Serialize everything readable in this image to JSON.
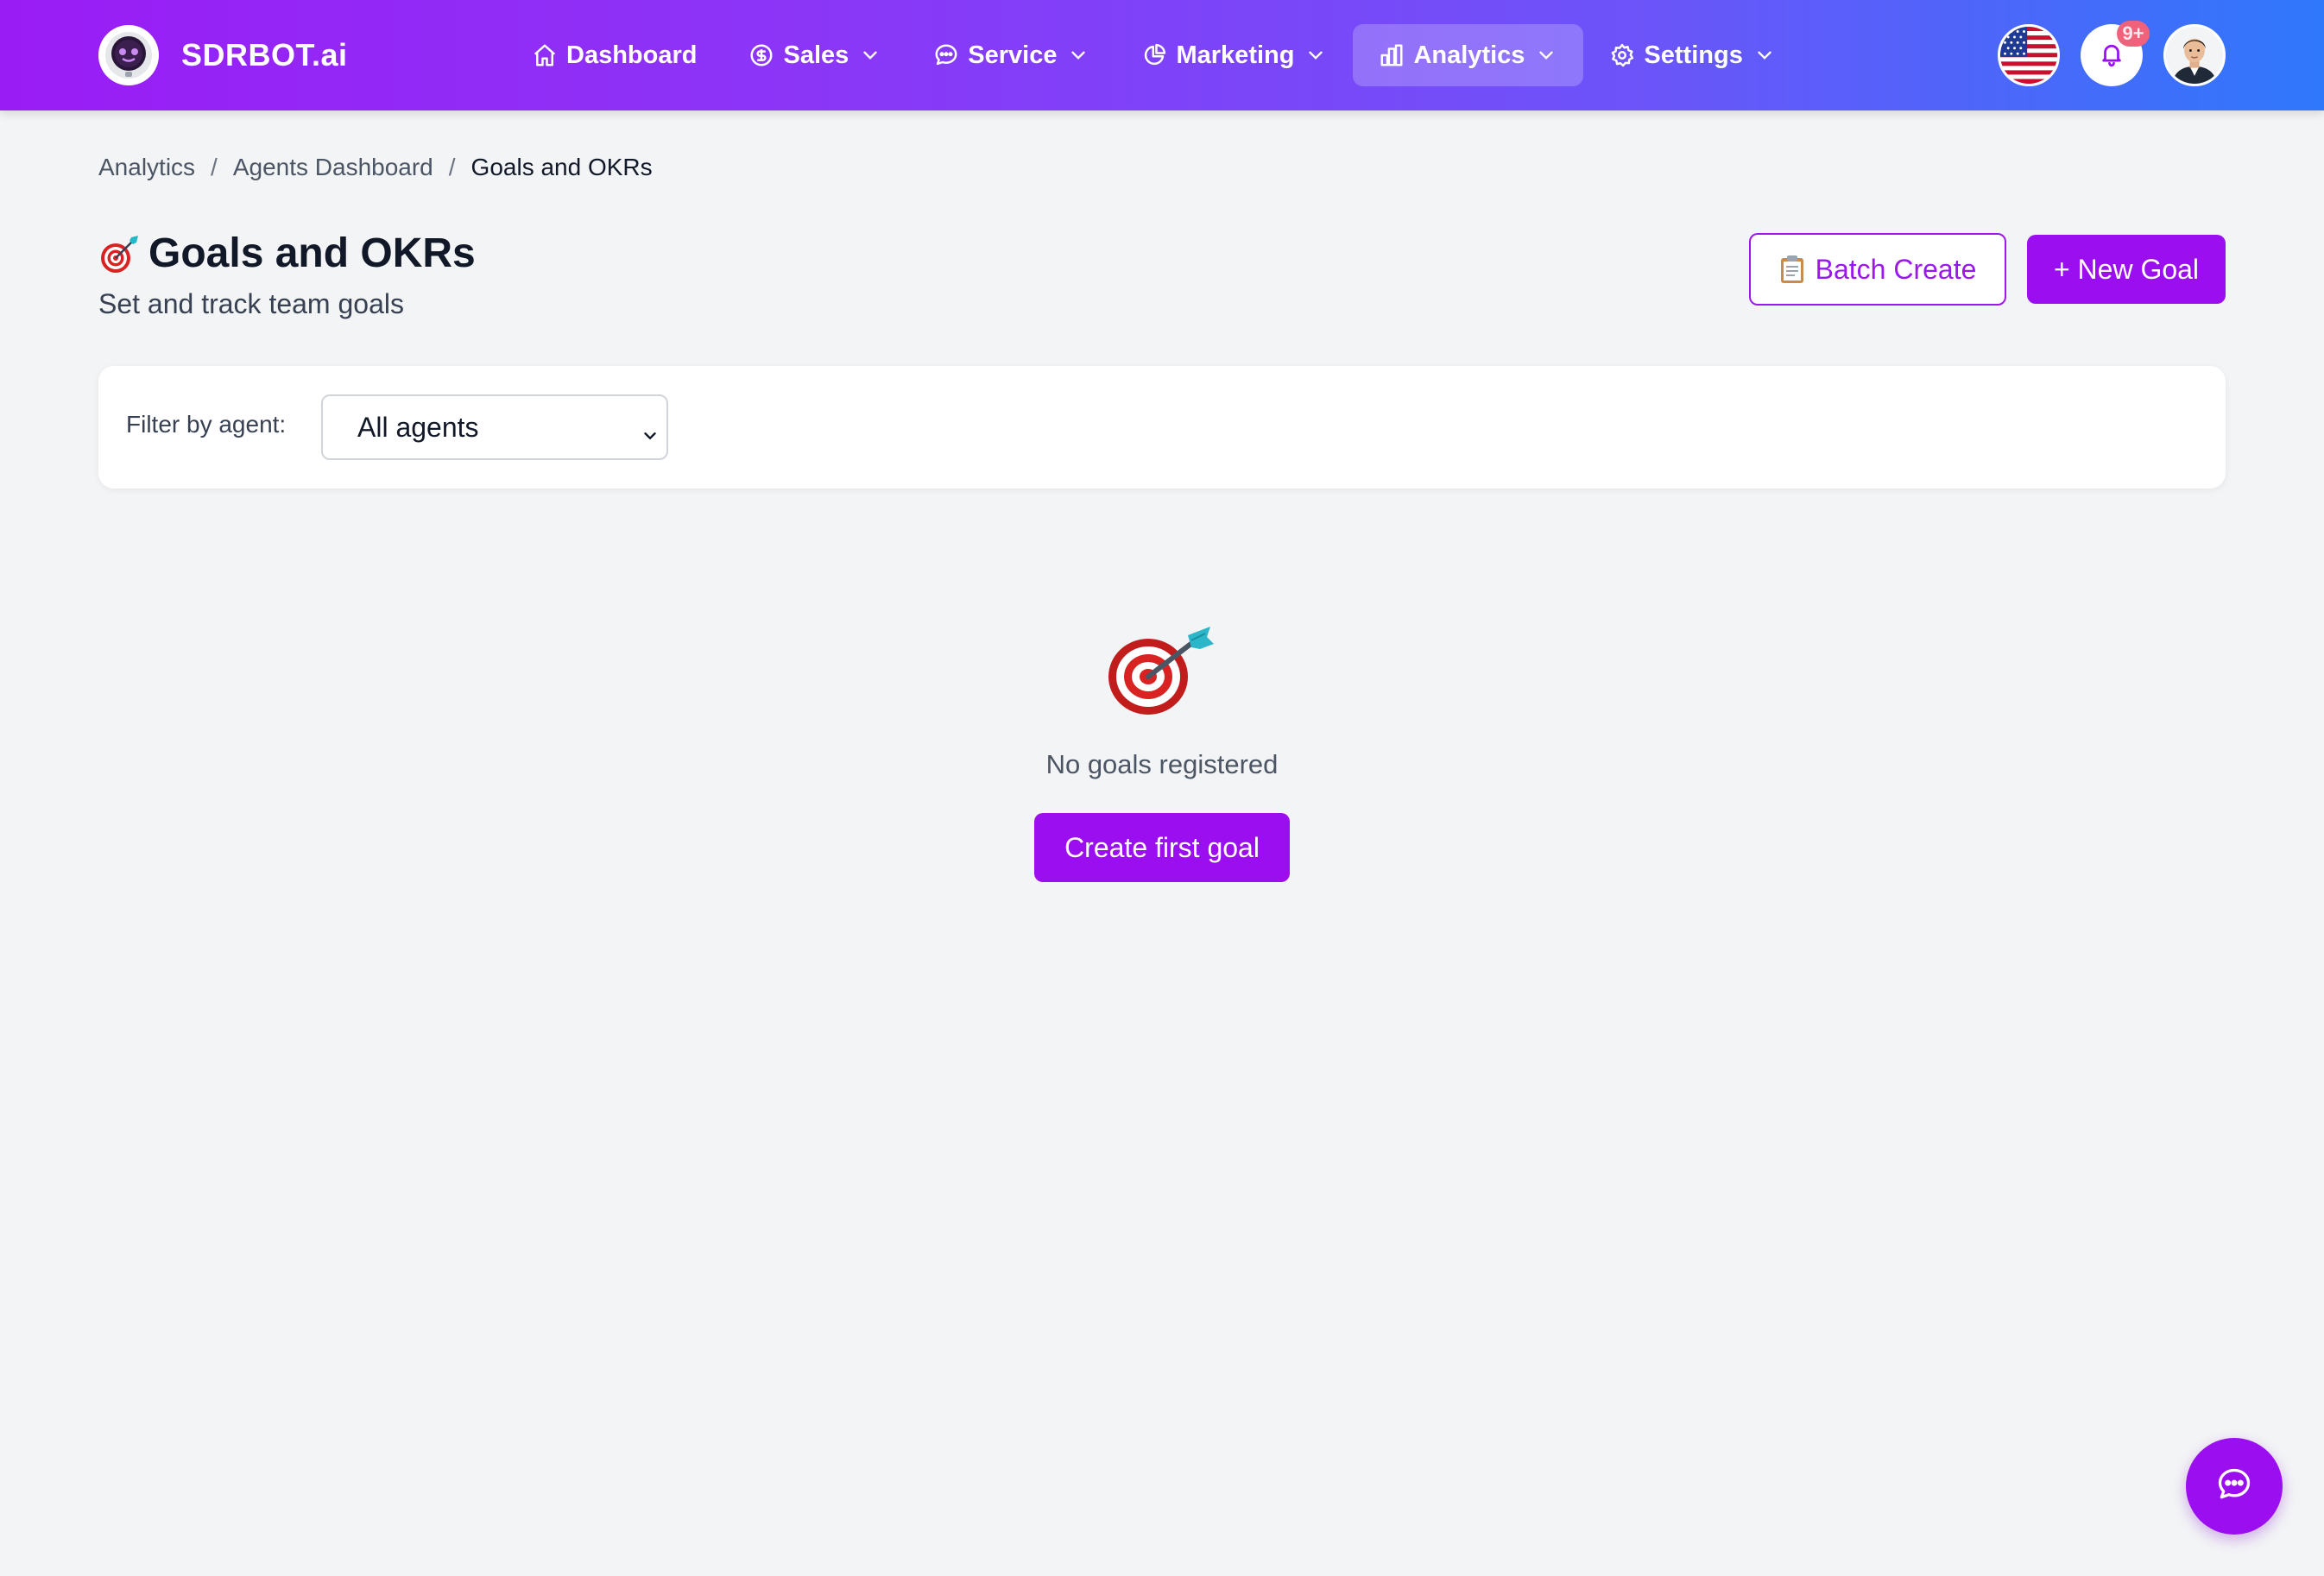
{
  "app": {
    "brand_name": "SDRBOT.ai",
    "accent_color": "#9b0ef0",
    "header_gradient": [
      "#9a1cf5",
      "#2f78fb"
    ]
  },
  "nav": {
    "items": [
      {
        "label": "Dashboard",
        "icon": "home-icon",
        "has_dropdown": false,
        "active": false
      },
      {
        "label": "Sales",
        "icon": "dollar-circle-icon",
        "has_dropdown": true,
        "active": false
      },
      {
        "label": "Service",
        "icon": "chat-bubble-icon",
        "has_dropdown": true,
        "active": false
      },
      {
        "label": "Marketing",
        "icon": "pie-chart-icon",
        "has_dropdown": true,
        "active": false
      },
      {
        "label": "Analytics",
        "icon": "bar-chart-icon",
        "has_dropdown": true,
        "active": true
      },
      {
        "label": "Settings",
        "icon": "gear-icon",
        "has_dropdown": true,
        "active": false
      }
    ],
    "notification_badge": "9+",
    "language_icon": "us-flag-icon"
  },
  "breadcrumb": [
    "Analytics",
    "Agents Dashboard",
    "Goals and OKRs"
  ],
  "header": {
    "title": "Goals and OKRs",
    "subtitle": "Set and track team goals",
    "batch_create_label": "Batch Create",
    "new_goal_label": "+ New Goal"
  },
  "filter": {
    "label": "Filter by agent:",
    "selected": "All agents"
  },
  "empty_state": {
    "icon": "target-dart-icon",
    "message": "No goals registered",
    "button_label": "Create first goal"
  },
  "chat": {
    "icon": "chat-bubble-icon"
  }
}
